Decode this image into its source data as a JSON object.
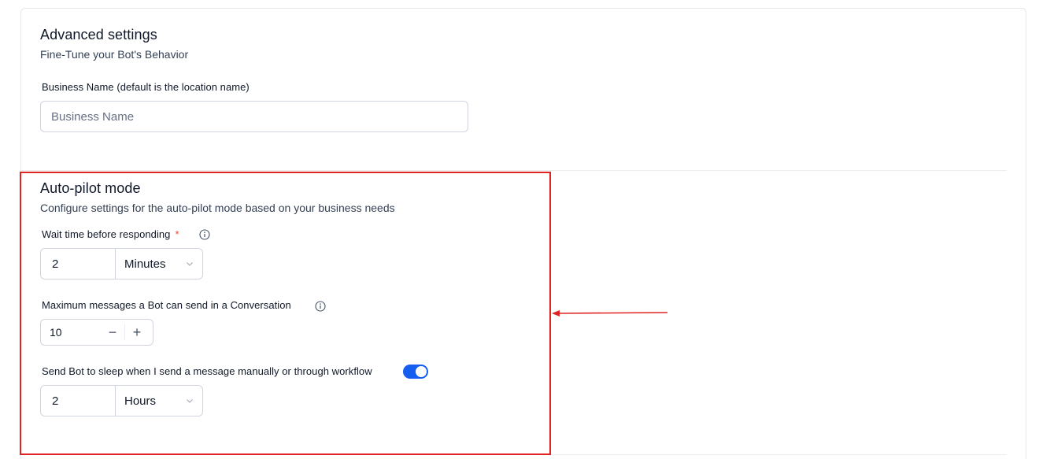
{
  "advanced": {
    "title": "Advanced settings",
    "subtitle": "Fine-Tune your Bot's Behavior",
    "business_name_label": "Business Name (default is the location name)",
    "business_name_placeholder": "Business Name",
    "business_name_value": ""
  },
  "autopilot": {
    "title": "Auto-pilot mode",
    "subtitle": "Configure settings for the auto-pilot mode based on your business needs",
    "wait_time": {
      "label": "Wait time before responding",
      "required_marker": "*",
      "value": "2",
      "unit": "Minutes"
    },
    "max_messages": {
      "label": "Maximum messages a Bot can send in a Conversation",
      "value": "10",
      "decrement": "−",
      "increment": "+"
    },
    "sleep": {
      "label": "Send Bot to sleep when I send a message manually or through workflow",
      "toggle_on": true,
      "value": "2",
      "unit": "Hours"
    }
  },
  "annotation": {
    "color": "#e02424"
  },
  "colors": {
    "accent": "#155eef",
    "required": "#f04438",
    "border": "#d0d5dd"
  }
}
